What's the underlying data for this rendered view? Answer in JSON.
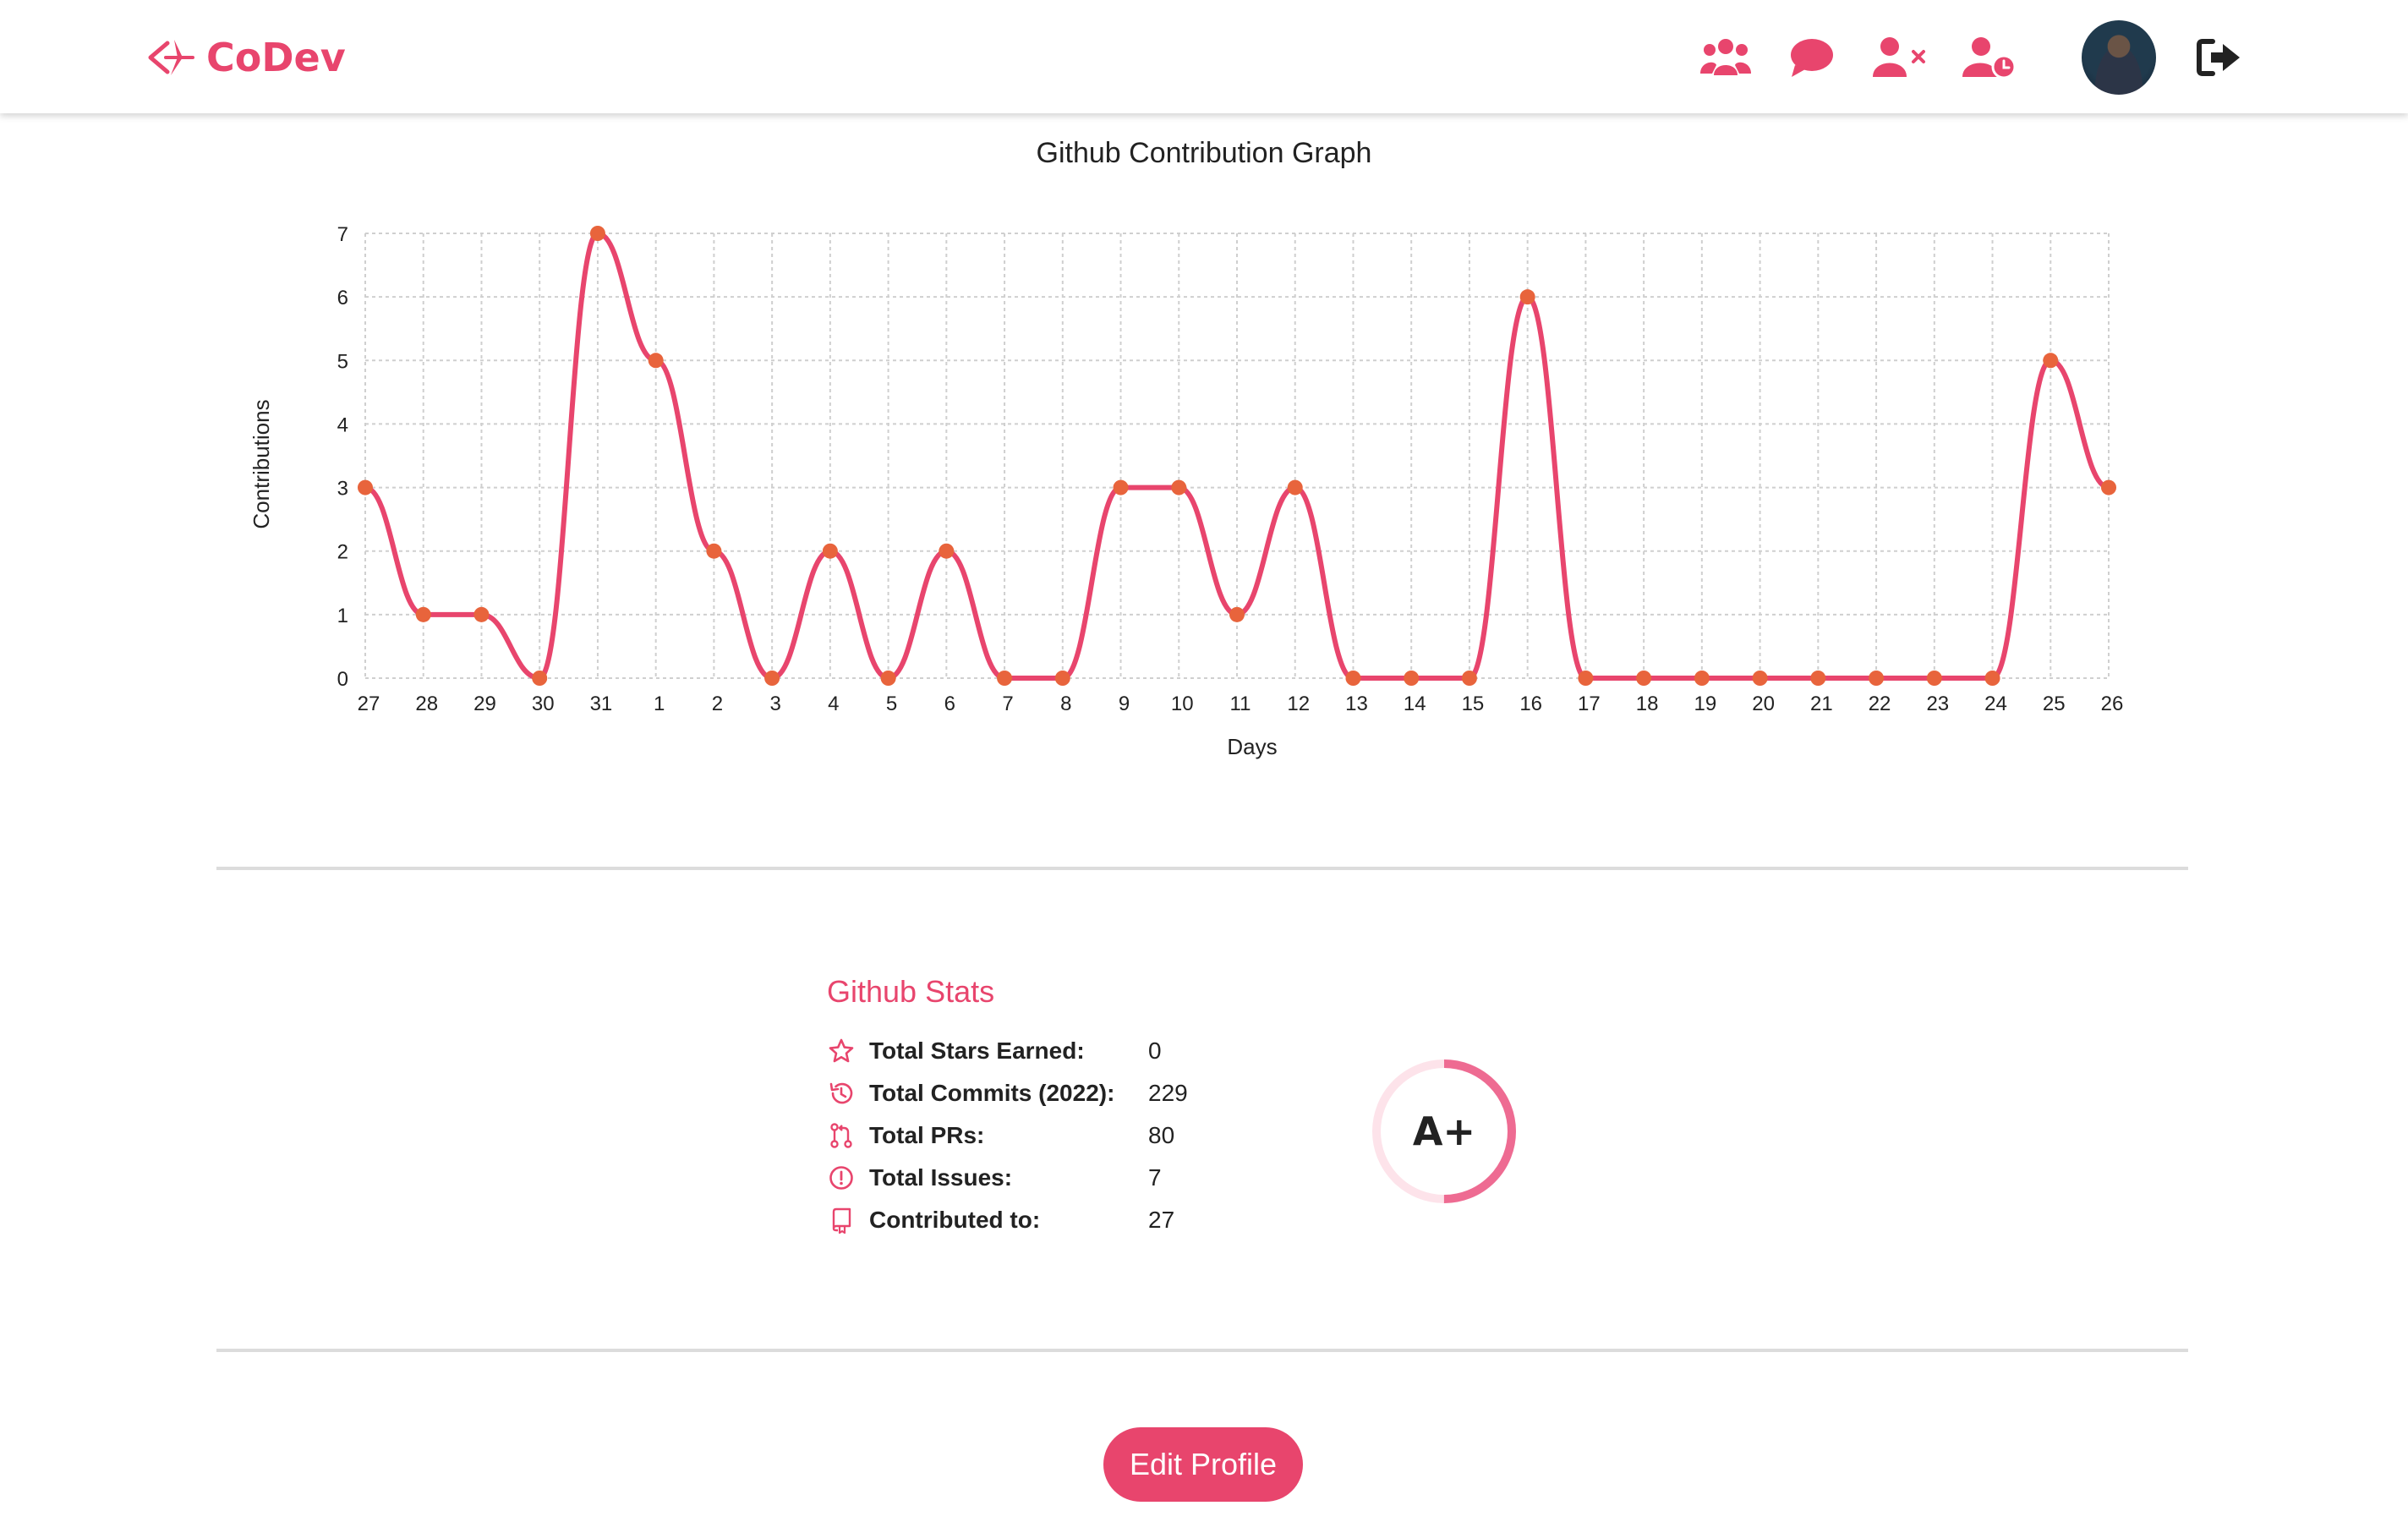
{
  "app": {
    "brand": "CoDev",
    "brand_color": "#e8456d"
  },
  "navbar": {
    "icons": [
      "users-icon",
      "chat-icon",
      "user-remove-icon",
      "user-pending-icon",
      "avatar",
      "logout-icon"
    ]
  },
  "chart_data": {
    "type": "line",
    "title": "Github Contribution Graph",
    "xlabel": "Days",
    "ylabel": "Contributions",
    "categories": [
      "27",
      "28",
      "29",
      "30",
      "31",
      "1",
      "2",
      "3",
      "4",
      "5",
      "6",
      "7",
      "8",
      "9",
      "10",
      "11",
      "12",
      "13",
      "14",
      "15",
      "16",
      "17",
      "18",
      "19",
      "20",
      "21",
      "22",
      "23",
      "24",
      "25",
      "26"
    ],
    "values": [
      3,
      1,
      1,
      0,
      7,
      5,
      2,
      0,
      2,
      0,
      2,
      0,
      0,
      3,
      3,
      1,
      3,
      0,
      0,
      0,
      6,
      0,
      0,
      0,
      0,
      0,
      0,
      0,
      0,
      5,
      3
    ],
    "ylim": [
      0,
      7
    ],
    "yticks": [
      0,
      1,
      2,
      3,
      4,
      5,
      6,
      7
    ],
    "grid": true,
    "line_color": "#e8456d",
    "point_color": "#e8643c"
  },
  "stats": {
    "title": "Github Stats",
    "rows": [
      {
        "icon": "star-icon",
        "label": "Total Stars Earned:",
        "value": "0"
      },
      {
        "icon": "history-icon",
        "label": "Total Commits (2022):",
        "value": "229"
      },
      {
        "icon": "pull-request-icon",
        "label": "Total PRs:",
        "value": "80"
      },
      {
        "icon": "issue-icon",
        "label": "Total Issues:",
        "value": "7"
      },
      {
        "icon": "repo-icon",
        "label": "Contributed to:",
        "value": "27"
      }
    ],
    "grade": "A+",
    "grade_progress": 0.5
  },
  "actions": {
    "edit_profile": "Edit Profile"
  }
}
